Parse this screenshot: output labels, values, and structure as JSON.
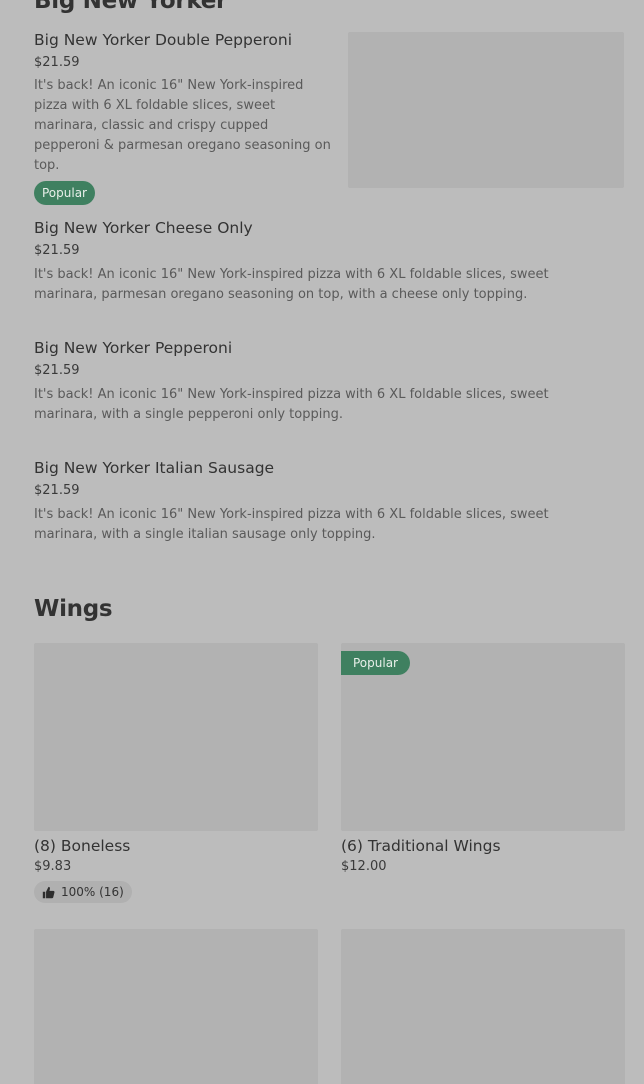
{
  "big_new_yorker": {
    "title": "Big New Yorker",
    "items": [
      {
        "name": "Big New Yorker Double Pepperoni",
        "price": "$21.59",
        "desc": "It's back! An iconic 16\" New York-inspired pizza with 6 XL foldable slices, sweet marinara, classic and crispy cupped pepperoni & parmesan oregano seasoning on top.",
        "badge": "Popular"
      },
      {
        "name": "Big New Yorker Cheese Only",
        "price": "$21.59",
        "desc": "It's back! An iconic 16\" New York-inspired pizza with 6 XL foldable slices, sweet marinara, parmesan oregano seasoning on top, with a cheese only topping."
      },
      {
        "name": "Big New Yorker Pepperoni",
        "price": "$21.59",
        "desc": "It's back! An iconic 16\" New York-inspired pizza with 6 XL foldable slices, sweet marinara, with a single pepperoni only topping."
      },
      {
        "name": "Big New Yorker Italian Sausage",
        "price": "$21.59",
        "desc": "It's back! An iconic 16\" New York-inspired pizza with 6 XL foldable slices, sweet marinara, with a single italian sausage only topping."
      }
    ]
  },
  "wings": {
    "title": "Wings",
    "cards": [
      {
        "name": "(8) Boneless",
        "price": "$9.83",
        "rating": "100% (16)",
        "icon": "thumbs-up-icon"
      },
      {
        "name": "(6) Traditional Wings",
        "price": "$12.00",
        "badge": "Popular"
      }
    ]
  },
  "colors": {
    "background": "#bcbcbc",
    "image_placeholder": "#b2b2b2",
    "badge": "#3f8060"
  }
}
